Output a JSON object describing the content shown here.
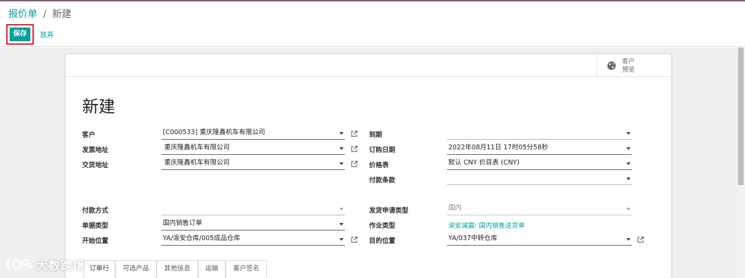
{
  "breadcrumb": {
    "parent": "报价单",
    "separator": "/",
    "current": "新建"
  },
  "toolbar": {
    "save_label": "保存",
    "discard_label": "放弃"
  },
  "button_box": {
    "customer_preview_line1": "客户",
    "customer_preview_line2": "预览"
  },
  "form": {
    "title": "新建",
    "customer": {
      "label": "客户",
      "value": "[C000533] 重庆隆鑫机车有限公司"
    },
    "invoice_address": {
      "label": "发票地址",
      "value": "重庆隆鑫机车有限公司"
    },
    "delivery_address": {
      "label": "交货地址",
      "value": "重庆隆鑫机车有限公司"
    },
    "expiration": {
      "label": "到期",
      "value": ""
    },
    "order_date": {
      "label": "订购日期",
      "value": "2022年08月11日 17时05分58秒"
    },
    "pricelist": {
      "label": "价格表",
      "value": "默认 CNY 价目表 (CNY)"
    },
    "payment_terms": {
      "label": "付款条款",
      "value": ""
    },
    "payment_method": {
      "label": "付款方式",
      "value": ""
    },
    "document_type": {
      "label": "单据类型",
      "value": "国内销售订单"
    },
    "start_location": {
      "label": "开始位置",
      "value": "YA/渝安仓库/005成品仓库"
    },
    "shipping_request_type": {
      "label": "发货申请类型",
      "value": "国内"
    },
    "operation_type": {
      "label": "作业类型",
      "value": "渝安减震: 国内销售送货单"
    },
    "destination_location": {
      "label": "目的位置",
      "value": "YA/037中转仓库"
    }
  },
  "tabs": [
    "订单行",
    "可选产品",
    "其他信息",
    "运输",
    "客户签名"
  ],
  "watermark": {
    "text": "大数跨境"
  },
  "colors": {
    "accent": "#00a09d",
    "brand_bar": "#875a7b",
    "highlight_border": "#e2262c"
  },
  "icons": {
    "preview": "globe-icon",
    "external": "external-link-icon",
    "dropdown": "caret-down-icon"
  }
}
